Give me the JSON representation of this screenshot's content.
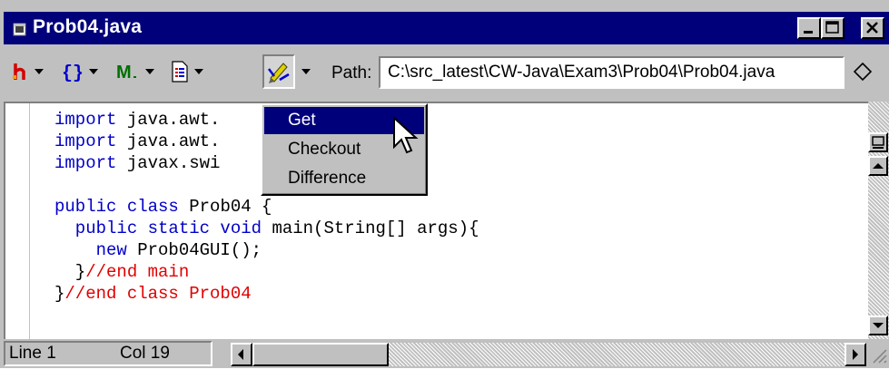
{
  "window": {
    "title": "Prob04.java"
  },
  "toolbar": {
    "path_label": "Path:",
    "path_value": "C:\\src_latest\\CW-Java\\Exam3\\Prob04\\Prob04.java"
  },
  "menu": {
    "items": [
      "Get",
      "Checkout",
      "Difference"
    ],
    "selected": "Get"
  },
  "code": {
    "lines": [
      [
        [
          "kw",
          "import "
        ],
        [
          "pl",
          "java.awt."
        ]
      ],
      [
        [
          "kw",
          "import "
        ],
        [
          "pl",
          "java.awt."
        ]
      ],
      [
        [
          "kw",
          "import "
        ],
        [
          "pl",
          "javax.swi"
        ]
      ],
      [],
      [
        [
          "kw",
          "public class "
        ],
        [
          "pl",
          "Prob04 {"
        ]
      ],
      [
        [
          "kw",
          "  public static void "
        ],
        [
          "pl",
          "main(String[] args){"
        ]
      ],
      [
        [
          "kw",
          "    new "
        ],
        [
          "pl",
          "Prob04GUI();"
        ]
      ],
      [
        [
          "pl",
          "  }"
        ],
        [
          "cm",
          "//end main"
        ]
      ],
      [
        [
          "pl",
          "}"
        ],
        [
          "cm",
          "//end class Prob04"
        ]
      ]
    ]
  },
  "status": {
    "line": "Line 1",
    "col": "Col 19"
  },
  "colors": {
    "titlebar": "#00007b",
    "keyword": "#0000c8",
    "comment": "#e00000",
    "selection": "#00007b"
  }
}
